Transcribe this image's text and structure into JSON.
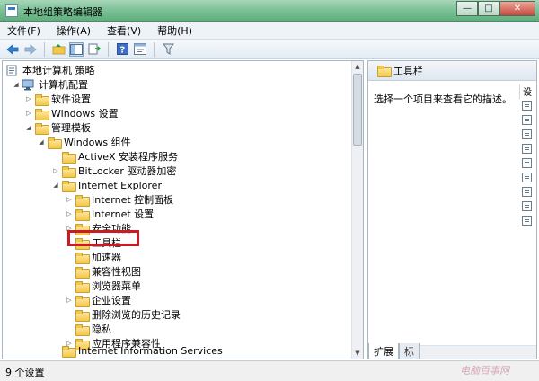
{
  "window": {
    "title": "本地组策略编辑器",
    "btn_min": "—",
    "btn_max": "□",
    "btn_close": "✕"
  },
  "menu": [
    "文件(F)",
    "操作(A)",
    "查看(V)",
    "帮助(H)"
  ],
  "toolbar": {
    "icons": [
      "back-arrow-icon",
      "forward-arrow-icon",
      "folder-up-icon",
      "show-hide-tree-icon",
      "export-list-icon",
      "help-icon",
      "properties-icon",
      "filter-icon"
    ]
  },
  "tree": {
    "nodes": [
      {
        "label": "本地计算机 策略"
      },
      {
        "label": "计算机配置"
      },
      {
        "label": "软件设置"
      },
      {
        "label": "Windows 设置"
      },
      {
        "label": "管理模板"
      },
      {
        "label": "Windows 组件"
      },
      {
        "label": "ActiveX 安装程序服务"
      },
      {
        "label": "BitLocker 驱动器加密"
      },
      {
        "label": "Internet Explorer"
      },
      {
        "label": "Internet 控制面板"
      },
      {
        "label": "Internet 设置"
      },
      {
        "label": "安全功能"
      },
      {
        "label": "工具栏"
      },
      {
        "label": "加速器"
      },
      {
        "label": "兼容性视图"
      },
      {
        "label": "浏览器菜单"
      },
      {
        "label": "企业设置"
      },
      {
        "label": "删除浏览的历史记录"
      },
      {
        "label": "隐私"
      },
      {
        "label": "应用程序兼容性"
      },
      {
        "label": "Internet Information Services"
      }
    ]
  },
  "detail": {
    "title": "工具栏",
    "description": "选择一个项目来查看它的描述。",
    "column_header": "设",
    "tabs": [
      "扩展",
      "标"
    ]
  },
  "status": {
    "text": "9 个设置"
  },
  "watermark": "电脑百事网"
}
